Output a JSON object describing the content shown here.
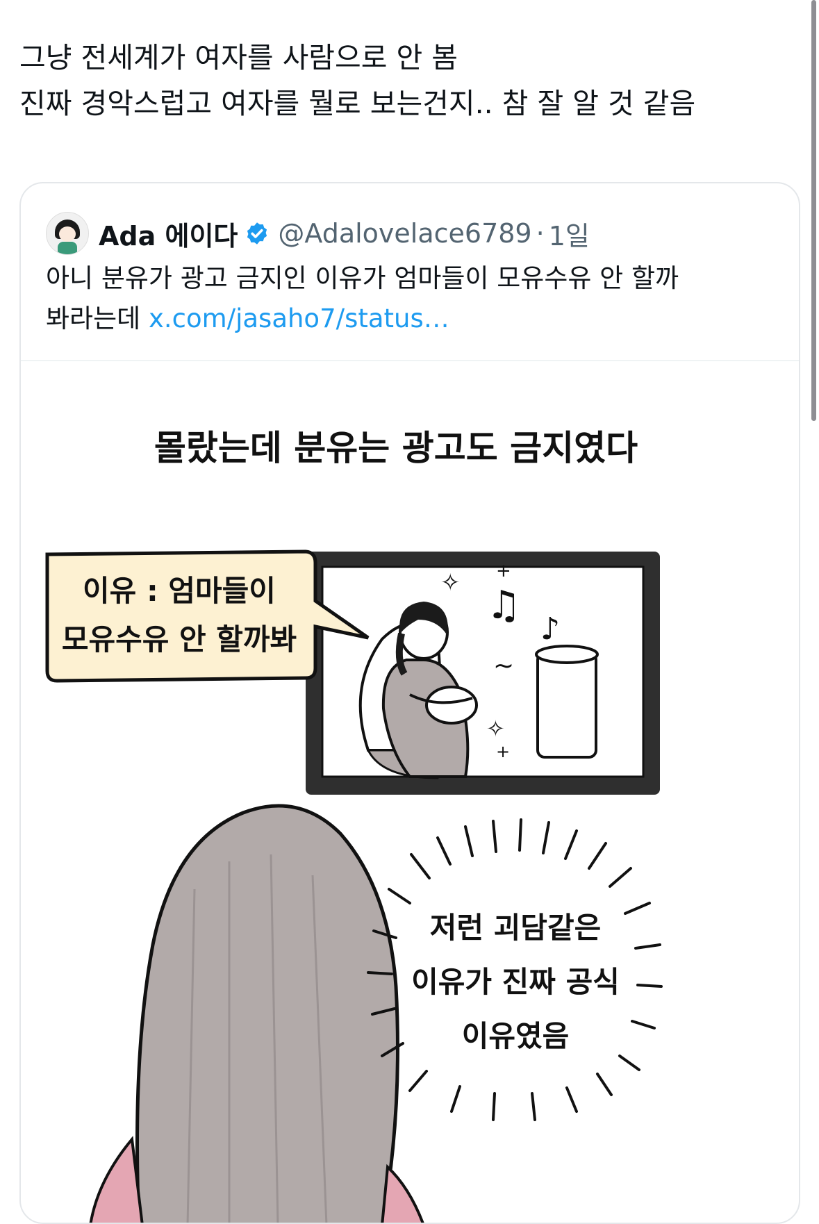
{
  "tweet": {
    "lines": [
      "그냥 전세계가 여자를 사람으로 안 봄",
      "진짜 경악스럽고 여자를 뭘로 보는건지.. 참 잘 알 것 같음"
    ]
  },
  "quote": {
    "name": "Ada 에이다",
    "handle": "@Adalovelace6789",
    "separator": "·",
    "time": "1일",
    "text_line1": "아니 분유가 광고 금지인 이유가 엄마들이 모유수유 안 할까",
    "text_line2": "봐라는데",
    "link": "x.com/jasaho7/status…",
    "verified_color": "#1d9bf0",
    "verified_icon": "verified-badge-icon"
  },
  "comic": {
    "title": "몰랐는데 분유는 광고도 금지였다",
    "bubble_line1": "이유 : 엄마들이",
    "bubble_line2": "모유수유 안 할까봐",
    "shout_line1": "저런 괴담같은",
    "shout_line2": "이유가 진짜 공식",
    "shout_line3": "이유였음",
    "colors": {
      "bubble_fill": "#fdf1d2",
      "hair": "#b2aaa9",
      "tv_frame": "#2f2f2f",
      "sweater": "#e4a6b3"
    }
  }
}
